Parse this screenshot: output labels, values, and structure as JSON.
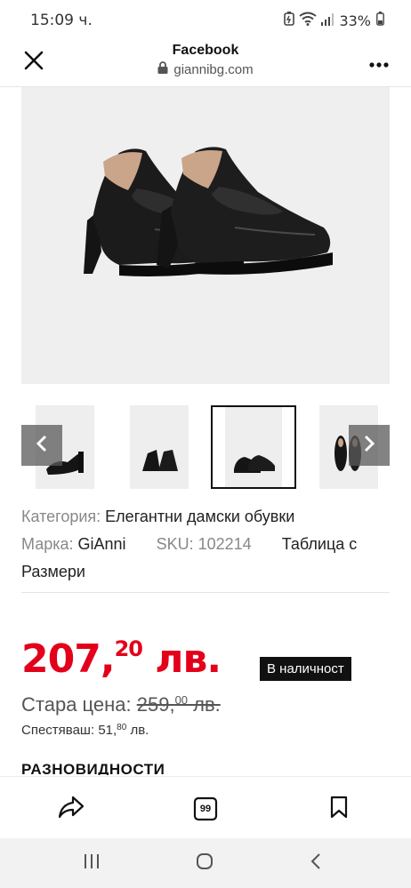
{
  "status_bar": {
    "time": "15:09 ч.",
    "battery": "33%",
    "icons": [
      "battery-saver-icon",
      "wifi-icon",
      "signal-icon",
      "battery-icon"
    ]
  },
  "browser": {
    "title": "Facebook",
    "url": "giannibg.com",
    "icons": {
      "close": "close-icon",
      "lock": "lock-icon",
      "more": "more-icon"
    }
  },
  "product": {
    "main_image_alt": "black-patent-loafer-heels",
    "thumbnails": [
      {
        "name": "thumb-side",
        "active": false
      },
      {
        "name": "thumb-back",
        "active": false
      },
      {
        "name": "thumb-pair",
        "active": true
      },
      {
        "name": "thumb-top",
        "active": false
      }
    ],
    "category_label": "Категория:",
    "category_value": "Елегантни дамски обувки",
    "brand_label": "Марка:",
    "brand_value": "GiAnni",
    "sku_label": "SKU:",
    "sku_value": "102214",
    "size_table_line1": "Таблица с",
    "size_table_line2": "Размери",
    "price_main": "207,",
    "price_cents": "20",
    "price_currency": " лв.",
    "stock": "В наличност",
    "old_price_label": "Стара цена: ",
    "old_price_main": "259,",
    "old_price_cents": "00",
    "old_price_currency": " лв.",
    "save_label": "Спестяваш: ",
    "save_main": "51,",
    "save_cents": "80",
    "save_currency": " лв.",
    "variations_heading": "РАЗНОВИДНОСТИ"
  },
  "toolbar": {
    "share_icon": "share-icon",
    "comments_count": "99",
    "bookmark_icon": "bookmark-icon"
  },
  "navbar": {
    "icons": [
      "recent-apps-icon",
      "home-icon",
      "back-icon"
    ]
  },
  "colors": {
    "price": "#e3001b",
    "badge_bg": "#111111",
    "image_bg": "#efefef"
  }
}
